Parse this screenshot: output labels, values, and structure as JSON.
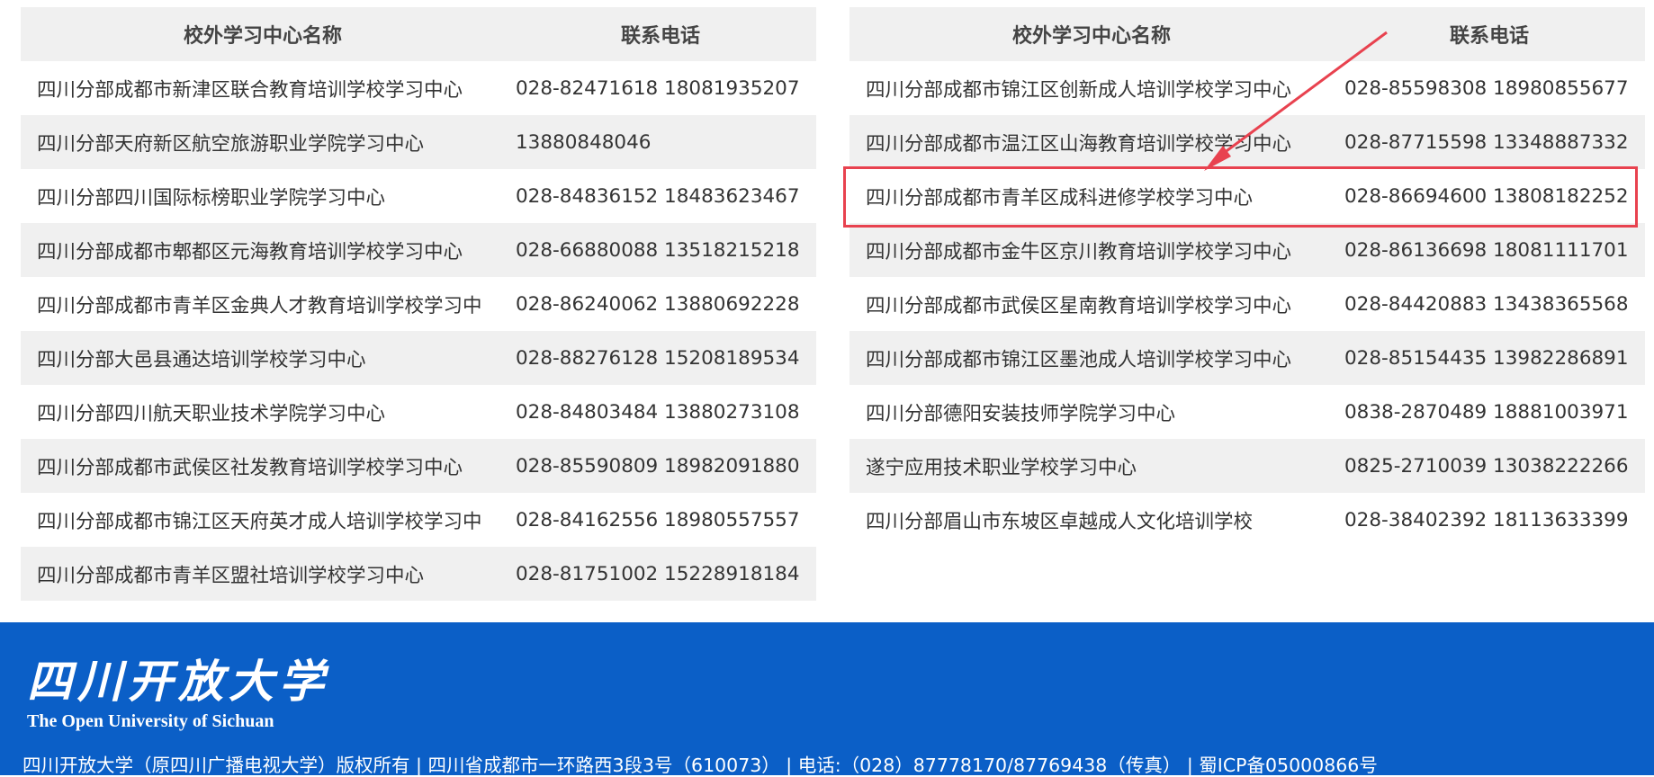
{
  "left_table": {
    "headers": [
      "校外学习中心名称",
      "联系电话"
    ],
    "rows": [
      {
        "name": "四川分部成都市新津区联合教育培训学校学习中心",
        "phone": "028-82471618 18081935207"
      },
      {
        "name": "四川分部天府新区航空旅游职业学院学习中心",
        "phone": "13880848046"
      },
      {
        "name": "四川分部四川国际标榜职业学院学习中心",
        "phone": "028-84836152 18483623467"
      },
      {
        "name": "四川分部成都市郫都区元海教育培训学校学习中心",
        "phone": "028-66880088 13518215218"
      },
      {
        "name": "四川分部成都市青羊区金典人才教育培训学校学习中",
        "phone": "028-86240062 13880692228"
      },
      {
        "name": "四川分部大邑县通达培训学校学习中心",
        "phone": "028-88276128 15208189534"
      },
      {
        "name": "四川分部四川航天职业技术学院学习中心",
        "phone": "028-84803484 13880273108"
      },
      {
        "name": "四川分部成都市武侯区社发教育培训学校学习中心",
        "phone": "028-85590809 18982091880"
      },
      {
        "name": "四川分部成都市锦江区天府英才成人培训学校学习中",
        "phone": "028-84162556 18980557557"
      },
      {
        "name": "四川分部成都市青羊区盟社培训学校学习中心",
        "phone": "028-81751002 15228918184"
      }
    ]
  },
  "right_table": {
    "headers": [
      "校外学习中心名称",
      "联系电话"
    ],
    "rows": [
      {
        "name": "四川分部成都市锦江区创新成人培训学校学习中心",
        "phone": "028-85598308 18980855677"
      },
      {
        "name": "四川分部成都市温江区山海教育培训学校学习中心",
        "phone": "028-87715598 13348887332"
      },
      {
        "name": "四川分部成都市青羊区成科进修学校学习中心",
        "phone": "028-86694600 13808182252"
      },
      {
        "name": "四川分部成都市金牛区京川教育培训学校学习中心",
        "phone": "028-86136698 18081111701"
      },
      {
        "name": "四川分部成都市武侯区星南教育培训学校学习中心",
        "phone": "028-84420883 13438365568"
      },
      {
        "name": "四川分部成都市锦江区墨池成人培训学校学习中心",
        "phone": "028-85154435 13982286891"
      },
      {
        "name": "四川分部德阳安装技师学院学习中心",
        "phone": "0838-2870489 18881003971"
      },
      {
        "name": "遂宁应用技术职业学校学习中心",
        "phone": "0825-2710039 13038222266"
      },
      {
        "name": "四川分部眉山市东坡区卓越成人文化培训学校",
        "phone": "028-38402392 18113633399"
      }
    ]
  },
  "annotation": {
    "highlighted_row": 2,
    "color": "#e8424f"
  },
  "footer": {
    "logo_cn": "四川开放大学",
    "logo_en": "The Open University of Sichuan",
    "copyright": "四川开放大学（原四川广播电视大学）版权所有 | 四川省成都市一环路西3段3号（610073） | 电话:（028）87778170/87769438（传真） | 蜀ICP备05000866号",
    "background_color": "#0b5fc7"
  }
}
